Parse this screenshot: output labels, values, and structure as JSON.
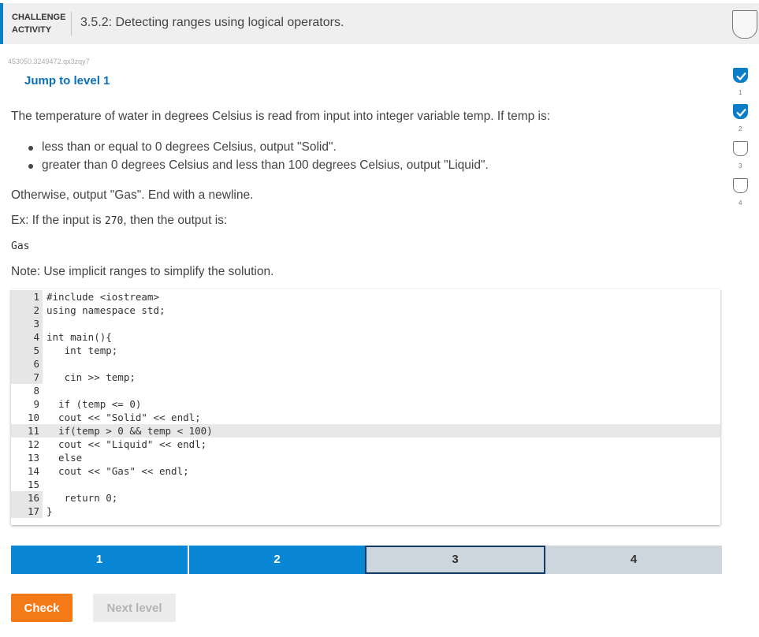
{
  "header": {
    "activity_type_line1": "CHALLENGE",
    "activity_type_line2": "ACTIVITY",
    "title": "3.5.2: Detecting ranges using logical operators.",
    "accent_color": "#0a7fc8"
  },
  "activity_id": "453050.3249472.qx3zqy7",
  "jump_link": "Jump to level 1",
  "side_levels": [
    {
      "num": "1",
      "status": "complete"
    },
    {
      "num": "2",
      "status": "complete"
    },
    {
      "num": "3",
      "status": "incomplete"
    },
    {
      "num": "4",
      "status": "incomplete"
    }
  ],
  "prompt": "The temperature of water in degrees Celsius is read from input into integer variable temp. If temp is:",
  "bullets": [
    "less than or equal to 0 degrees Celsius, output \"Solid\".",
    "greater than 0 degrees Celsius and less than 100 degrees Celsius, output \"Liquid\"."
  ],
  "otherwise": "Otherwise, output \"Gas\". End with a newline.",
  "example": {
    "prefix": "Ex: If the input is ",
    "input": "270",
    "suffix": ", then the output is:"
  },
  "sample_output": "Gas",
  "note": "Note: Use implicit ranges to simplify the solution.",
  "code_lines": [
    {
      "n": "1",
      "text": "#include <iostream>"
    },
    {
      "n": "2",
      "text": "using namespace std;"
    },
    {
      "n": "3",
      "text": ""
    },
    {
      "n": "4",
      "text": "int main(){"
    },
    {
      "n": "5",
      "text": "   int temp;"
    },
    {
      "n": "6",
      "text": ""
    },
    {
      "n": "7",
      "text": "   cin >> temp;"
    },
    {
      "n": "8",
      "text": ""
    },
    {
      "n": "9",
      "text": "  if (temp <= 0)"
    },
    {
      "n": "10",
      "text": "  cout << \"Solid\" << endl;"
    },
    {
      "n": "11",
      "text": "  if(temp > 0 && temp < 100)"
    },
    {
      "n": "12",
      "text": "  cout << \"Liquid\" << endl;"
    },
    {
      "n": "13",
      "text": "  else"
    },
    {
      "n": "14",
      "text": "  cout << \"Gas\" << endl;"
    },
    {
      "n": "15",
      "text": ""
    },
    {
      "n": "16",
      "text": "   return 0;"
    },
    {
      "n": "17",
      "text": "}"
    }
  ],
  "progress": [
    {
      "label": "1",
      "status": "complete"
    },
    {
      "label": "2",
      "status": "complete"
    },
    {
      "label": "3",
      "status": "current"
    },
    {
      "label": "4",
      "status": "pending"
    }
  ],
  "buttons": {
    "check": "Check",
    "next_level": "Next level"
  },
  "colors": {
    "check_button": "#f47a18",
    "progress_complete": "#0a87d4",
    "progress_pending": "#cdd5dd"
  }
}
